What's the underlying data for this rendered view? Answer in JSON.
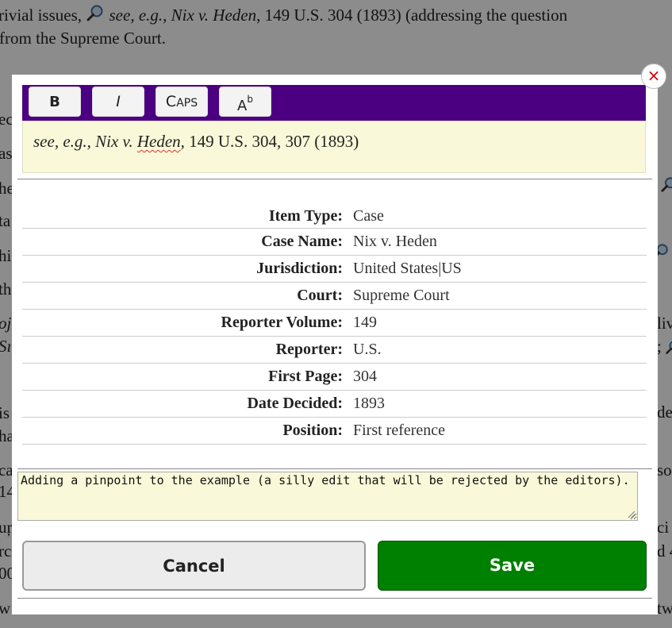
{
  "background": {
    "line1": "rivial issues,",
    "line1_cite": "see, e.g., Nix v. Heden",
    "line1_rest": ", 149 U.S. 304 (1893) (addressing the question",
    "line2": "from the Supreme Court."
  },
  "toolbar": {
    "bold_label": "B",
    "italic_label": "I",
    "caps_label_first": "C",
    "caps_label_rest": "APS",
    "super_label": "A",
    "super_sup": "b"
  },
  "editor": {
    "signal": "see, e.g.,",
    "case_a": "Nix v.",
    "case_b": "Heden",
    "rest": ", 149 U.S. 304, 307 (1893)"
  },
  "fields": [
    {
      "label": "Item Type:",
      "value": "Case"
    },
    {
      "label": "Case Name:",
      "value": "Nix v. Heden"
    },
    {
      "label": "Jurisdiction:",
      "value": "United States|US"
    },
    {
      "label": "Court:",
      "value": "Supreme Court"
    },
    {
      "label": "Reporter Volume:",
      "value": "149"
    },
    {
      "label": "Reporter:",
      "value": "U.S."
    },
    {
      "label": "First Page:",
      "value": "304"
    },
    {
      "label": "Date Decided:",
      "value": "1893"
    },
    {
      "label": "Position:",
      "value": "First reference"
    }
  ],
  "notes": {
    "value": "Adding a pinpoint to the example (a silly edit that will be rejected by the editors)."
  },
  "buttons": {
    "cancel_label": "Cancel",
    "save_label": "Save"
  },
  "close_symbol": "×",
  "colors": {
    "toolbar": "#4b0082",
    "save": "#008000",
    "editor_bg": "#f9f9d9",
    "close": "#cc0000"
  }
}
